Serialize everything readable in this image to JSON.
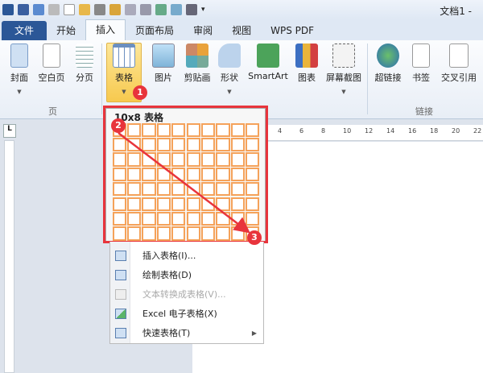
{
  "window": {
    "title": "文档1 -"
  },
  "tabs": [
    "文件",
    "开始",
    "插入",
    "页面布局",
    "审阅",
    "视图",
    "WPS PDF"
  ],
  "ribbon": {
    "page_group": {
      "label": "页",
      "buttons": [
        "封面",
        "空白页",
        "分页"
      ]
    },
    "table_button": "表格",
    "illustrations": [
      "图片",
      "剪贴画",
      "形状",
      "SmartArt",
      "图表",
      "屏幕截图"
    ],
    "links_group": {
      "label": "链接",
      "buttons": [
        "超链接",
        "书签",
        "交叉引用"
      ]
    }
  },
  "ruler": {
    "labels": [
      "4",
      "6",
      "8",
      "10",
      "12",
      "14",
      "16",
      "18",
      "20",
      "22"
    ],
    "corner": "L"
  },
  "picker": {
    "title": "10x8 表格",
    "cols": 10,
    "rows": 8
  },
  "menu": [
    {
      "label": "插入表格(I)...",
      "disabled": false
    },
    {
      "label": "绘制表格(D)",
      "disabled": false
    },
    {
      "label": "文本转换成表格(V)...",
      "disabled": true
    },
    {
      "label": "Excel 电子表格(X)",
      "disabled": false
    },
    {
      "label": "快速表格(T)",
      "disabled": false,
      "submenu": true
    }
  ],
  "annotations": [
    "1",
    "2",
    "3"
  ],
  "colors": {
    "accent": "#e8343c",
    "file_tab": "#2b5797",
    "cell_border": "#f5a25a"
  }
}
